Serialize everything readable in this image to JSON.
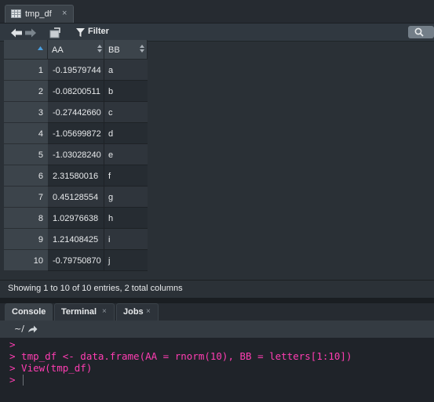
{
  "data_tab": {
    "title": "tmp_df",
    "close": "×"
  },
  "toolbar": {
    "filter_label": "Filter"
  },
  "table": {
    "columns": [
      "AA",
      "BB"
    ],
    "rows": [
      {
        "n": "1",
        "aa": "-0.19579744",
        "bb": "a"
      },
      {
        "n": "2",
        "aa": "-0.08200511",
        "bb": "b"
      },
      {
        "n": "3",
        "aa": "-0.27442660",
        "bb": "c"
      },
      {
        "n": "4",
        "aa": "-1.05699872",
        "bb": "d"
      },
      {
        "n": "5",
        "aa": "-1.03028240",
        "bb": "e"
      },
      {
        "n": "6",
        "aa": "2.31580016",
        "bb": "f"
      },
      {
        "n": "7",
        "aa": "0.45128554",
        "bb": "g"
      },
      {
        "n": "8",
        "aa": "1.02976638",
        "bb": "h"
      },
      {
        "n": "9",
        "aa": "1.21408425",
        "bb": "i"
      },
      {
        "n": "10",
        "aa": "-0.79750870",
        "bb": "j"
      }
    ]
  },
  "status": "Showing 1 to 10 of 10 entries, 2 total columns",
  "console_tabs": [
    {
      "label": "Console",
      "close": ""
    },
    {
      "label": "Terminal",
      "close": "×"
    },
    {
      "label": "Jobs",
      "close": "×"
    }
  ],
  "path": "~/",
  "console_lines": [
    ">",
    "> tmp_df <- data.frame(AA = rnorm(10), BB = letters[1:10])",
    "> View(tmp_df)",
    ">"
  ],
  "colors": {
    "accent": "#4a9fe0",
    "console_text": "#ff3db2",
    "background": "#2a3036"
  },
  "icons": [
    "table-icon",
    "back-arrow-icon",
    "forward-arrow-icon",
    "popout-icon",
    "filter-icon",
    "search-icon",
    "sort-icon",
    "share-arrow-icon"
  ]
}
